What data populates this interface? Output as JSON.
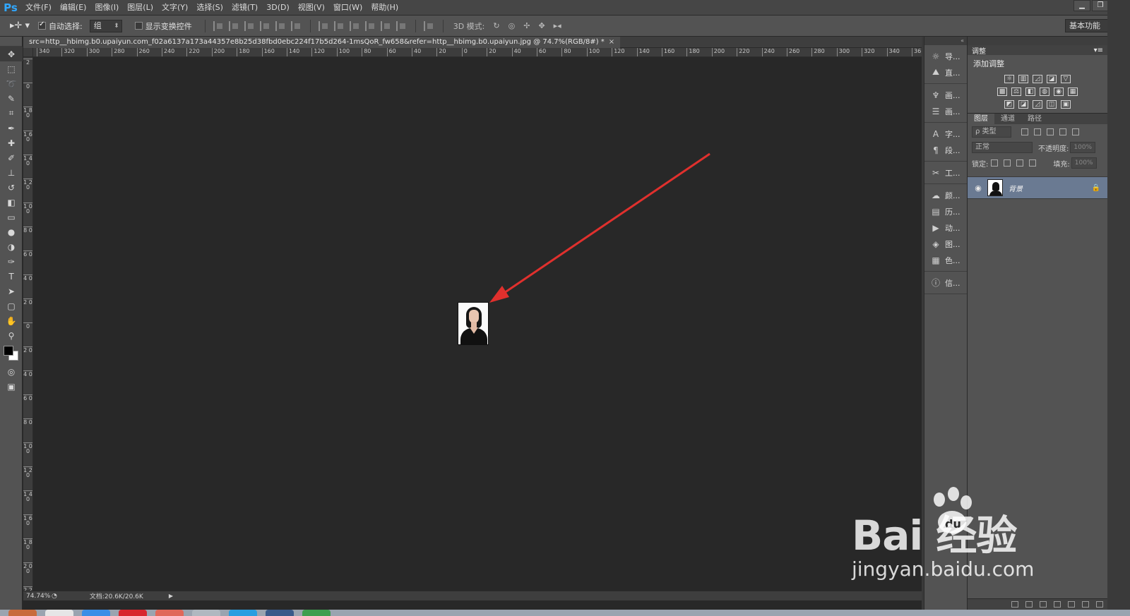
{
  "app": {
    "logo": "Ps"
  },
  "menu": [
    "文件(F)",
    "编辑(E)",
    "图像(I)",
    "图层(L)",
    "文字(Y)",
    "选择(S)",
    "滤镜(T)",
    "3D(D)",
    "视图(V)",
    "窗口(W)",
    "帮助(H)"
  ],
  "options": {
    "tool_glyph": "▸✛ ▾",
    "auto_select_label": "自动选择:",
    "auto_select_checked": true,
    "auto_select_value": "组",
    "show_transform_label": "显示变换控件",
    "show_transform_checked": false,
    "mode_3d_label": "3D 模式:",
    "workspace": "基本功能"
  },
  "document": {
    "tab_title": "src=http__hbimg.b0.upaiyun.com_f02a6137a173a44357e8b25d38fbd0ebc224f17b5d264-1msQoR_fw658&refer=http__hbimg.b0.upaiyun.jpg @ 74.7%(RGB/8#) *",
    "close_glyph": "×",
    "zoom": "74.74%",
    "doc_size": "文档:20.6K/20.6K",
    "status_arrow": "▶"
  },
  "rulers": {
    "horizontal": [
      "340",
      "320",
      "300",
      "280",
      "260",
      "240",
      "220",
      "200",
      "180",
      "160",
      "140",
      "120",
      "100",
      "80",
      "60",
      "40",
      "20",
      "0",
      "20",
      "40",
      "60",
      "80",
      "100",
      "120",
      "140",
      "160",
      "180",
      "200",
      "220",
      "240",
      "260",
      "280",
      "300",
      "320",
      "340",
      "36"
    ],
    "vertical": [
      "2",
      "0",
      "1 8 0",
      "1 6 0",
      "1 4 0",
      "1 2 0",
      "1 0 0",
      "8 0",
      "6 0",
      "4 0",
      "2 0",
      "0",
      "2 0",
      "4 0",
      "6 0",
      "8 0",
      "1 0 0",
      "1 2 0",
      "1 4 0",
      "1 6 0",
      "1 8 0",
      "2 0 0",
      "2 2 0"
    ]
  },
  "tools": [
    {
      "name": "move-tool",
      "glyph": "✥",
      "active": true
    },
    {
      "name": "marquee-tool",
      "glyph": "⬚"
    },
    {
      "name": "lasso-tool",
      "glyph": "➰"
    },
    {
      "name": "quick-select-tool",
      "glyph": "✎"
    },
    {
      "name": "crop-tool",
      "glyph": "⌗"
    },
    {
      "name": "eyedropper-tool",
      "glyph": "✒"
    },
    {
      "name": "healing-tool",
      "glyph": "✚"
    },
    {
      "name": "brush-tool",
      "glyph": "✐"
    },
    {
      "name": "stamp-tool",
      "glyph": "⊥"
    },
    {
      "name": "history-brush-tool",
      "glyph": "↺"
    },
    {
      "name": "eraser-tool",
      "glyph": "◧"
    },
    {
      "name": "gradient-tool",
      "glyph": "▭"
    },
    {
      "name": "blur-tool",
      "glyph": "●"
    },
    {
      "name": "dodge-tool",
      "glyph": "◑"
    },
    {
      "name": "pen-tool",
      "glyph": "✑"
    },
    {
      "name": "type-tool",
      "glyph": "T"
    },
    {
      "name": "path-select-tool",
      "glyph": "➤"
    },
    {
      "name": "shape-tool",
      "glyph": "▢"
    },
    {
      "name": "hand-tool",
      "glyph": "✋"
    },
    {
      "name": "zoom-tool",
      "glyph": "⚲"
    }
  ],
  "tool_extras": {
    "swap_glyph": "⇆",
    "quickmask_glyph": "◎",
    "screenmode_glyph": "▣"
  },
  "strip": {
    "collapse_glyph": "«",
    "groups": [
      [
        {
          "icon": "☼",
          "label": "导..."
        },
        {
          "icon": "⛰",
          "label": "直..."
        }
      ],
      [
        {
          "icon": "♆",
          "label": "画..."
        },
        {
          "icon": "☰",
          "label": "画..."
        }
      ],
      [
        {
          "icon": "A",
          "label": "字..."
        },
        {
          "icon": "¶",
          "label": "段..."
        }
      ],
      [
        {
          "icon": "✂",
          "label": "工..."
        }
      ],
      [
        {
          "icon": "☁",
          "label": "颜..."
        },
        {
          "icon": "▤",
          "label": "历..."
        },
        {
          "icon": "▶",
          "label": "动..."
        },
        {
          "icon": "◈",
          "label": "图..."
        },
        {
          "icon": "▦",
          "label": "色..."
        }
      ],
      [
        {
          "icon": "ⓘ",
          "label": "信..."
        }
      ]
    ]
  },
  "adjust": {
    "tab": "调整",
    "menu_glyph": "▾≡",
    "title": "添加调整",
    "rows": [
      [
        "☼",
        "▥",
        "◿",
        "◪",
        "▽"
      ],
      [
        "▩",
        "⚖",
        "◧",
        "◍",
        "◉",
        "▦"
      ],
      [
        "◩",
        "◪",
        "◿",
        "◫",
        "▣"
      ]
    ]
  },
  "layers": {
    "tabs": [
      "图层",
      "通道",
      "路径"
    ],
    "filter_label": "ρ 类型",
    "blend_mode": "正常",
    "opacity_label": "不透明度:",
    "opacity_value": "100%",
    "lock_label": "锁定:",
    "fill_label": "填充:",
    "fill_value": "100%",
    "items": [
      {
        "name": "背景",
        "visible_glyph": "◉",
        "lock_glyph": "🔒"
      }
    ]
  },
  "watermark": {
    "brand": "Bai  经验",
    "url": "jingyan.baidu.com"
  },
  "colors": {
    "accent": "#31a8ff",
    "arrow": "#e0302d",
    "selected_layer": "#6a7a92"
  }
}
